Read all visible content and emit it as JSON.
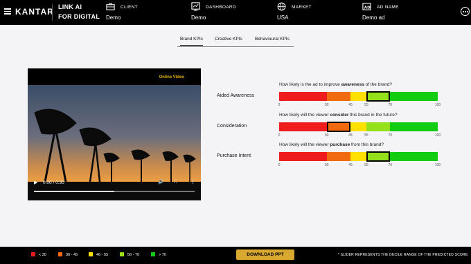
{
  "header": {
    "brand": "KANTAR",
    "product_line1": "LINK AI",
    "product_line2": "FOR DIGITAL",
    "groups": [
      {
        "icon": "briefcase-icon",
        "label": "CLIENT",
        "value": "Demo"
      },
      {
        "icon": "dashboard-icon",
        "label": "DASHBOARD",
        "value": "Demo"
      },
      {
        "icon": "globe-icon",
        "label": "MARKET",
        "value": "USA"
      },
      {
        "icon": "ad-name-icon",
        "label": "AD NAME",
        "value": "Demo ad"
      }
    ]
  },
  "tabs": [
    {
      "label": "Brand KPIs",
      "active": true
    },
    {
      "label": "Creative KPIs",
      "active": false
    },
    {
      "label": "Behavioural KPIs",
      "active": false
    }
  ],
  "video": {
    "tag": "Online Video",
    "time": "0:00 / 0:30",
    "progress": 0.5
  },
  "scale": {
    "ticks": [
      "0",
      "30",
      "45",
      "55",
      "70",
      "100"
    ],
    "tick_values": [
      0,
      30,
      45,
      55,
      70,
      100
    ],
    "colors": [
      "#ee1c1c",
      "#f26a10",
      "#ffe100",
      "#94e01b",
      "#11cc11"
    ]
  },
  "kpis": [
    {
      "label": "Aided Awareness",
      "q_pre": "How likely is the ad to improve ",
      "q_key": "awareness",
      "q_post": " of the brand?",
      "slider": [
        55,
        70
      ]
    },
    {
      "label": "Consideration",
      "q_pre": "How likely will the viewer ",
      "q_key": "consider",
      "q_post": " this brand in the future?",
      "slider": [
        30,
        45
      ]
    },
    {
      "label": "Purchase Intent",
      "q_pre": "How likely will the viewer ",
      "q_key": "purchase",
      "q_post": " from this brand?",
      "slider": [
        55,
        70
      ]
    }
  ],
  "footer": {
    "legend": [
      {
        "label": "< 30",
        "color": "#ee1c1c"
      },
      {
        "label": "30 - 45",
        "color": "#f26a10"
      },
      {
        "label": "46 - 55",
        "color": "#ffe100"
      },
      {
        "label": "56 - 70",
        "color": "#94e01b"
      },
      {
        "label": "> 70",
        "color": "#11cc11"
      }
    ],
    "download_label": "DOWNLOAD PPT",
    "note": "* SLIDER REPRESENTS THE DECILE RANGE OF THE PREDICTED SCORE"
  }
}
